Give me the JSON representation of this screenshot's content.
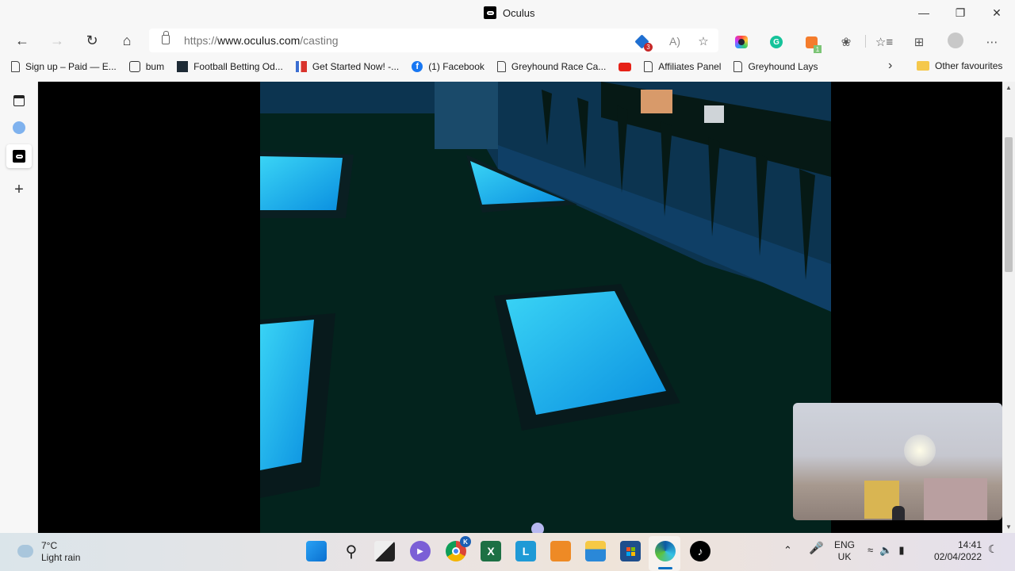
{
  "window": {
    "title": "Oculus",
    "controls": [
      "minimize",
      "restore",
      "close"
    ]
  },
  "navbar": {
    "url_prefix": "https://",
    "url_domain": "www.oculus.com",
    "url_path": "/casting",
    "extension_badges": {
      "tracker": "3",
      "ext_f": "1"
    }
  },
  "bookmarks": [
    {
      "label": "Sign up – Paid — E...",
      "icon": "page-icon"
    },
    {
      "label": "bum",
      "icon": "calendar-icon"
    },
    {
      "label": "Football Betting Od...",
      "icon": "betting-icon"
    },
    {
      "label": "Get Started Now! -...",
      "icon": "getstarted-icon"
    },
    {
      "label": "(1) Facebook",
      "icon": "facebook-icon"
    },
    {
      "label": "Greyhound Race Ca...",
      "icon": "page-icon"
    },
    {
      "label": "",
      "icon": "youtube-icon"
    },
    {
      "label": "Affiliates Panel",
      "icon": "page-icon"
    },
    {
      "label": "Greyhound Lays",
      "icon": "page-icon"
    }
  ],
  "other_favourites": "Other favourites",
  "taskbar": {
    "weather_temp": "7°C",
    "weather_desc": "Light rain",
    "chrome_badge": "K",
    "language_top": "ENG",
    "language_bottom": "UK",
    "time": "14:41",
    "date": "02/04/2022"
  },
  "colors": {
    "scene_floor": "#03231d",
    "window_glow": "#19c8f0",
    "edge_accent": "#0a6fc2"
  }
}
